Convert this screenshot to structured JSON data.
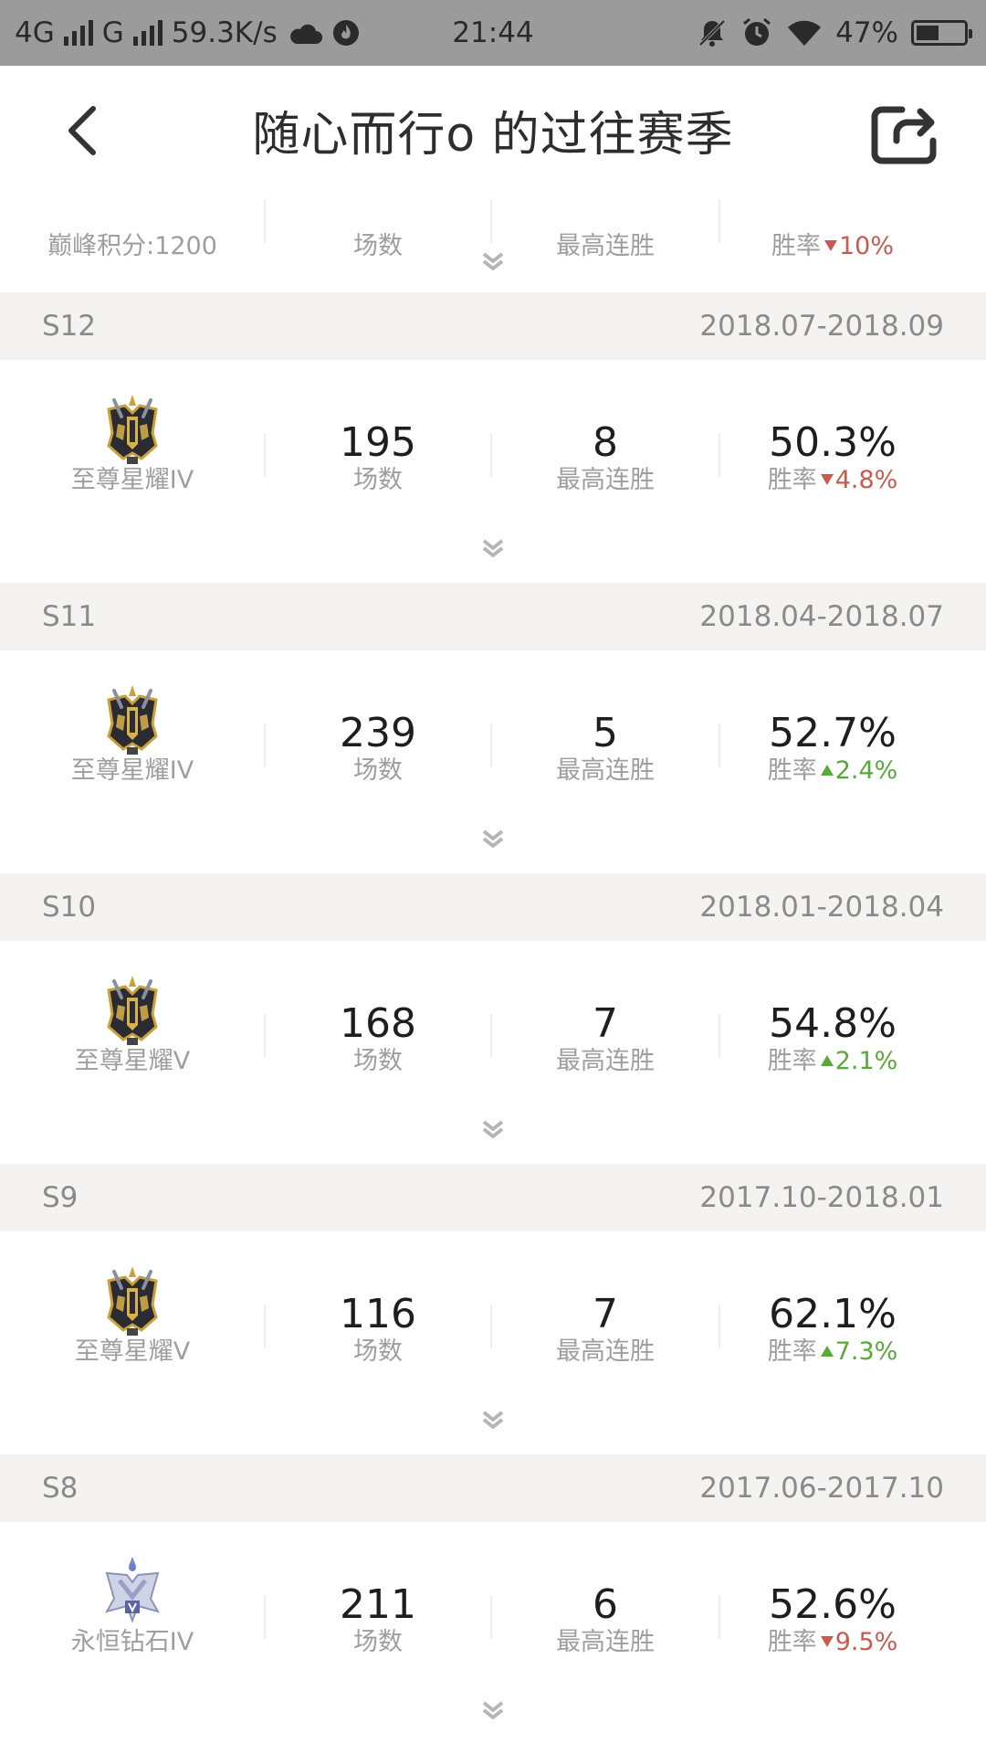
{
  "status_bar": {
    "network_1": "4G",
    "network_2": "G",
    "speed": "59.3K/s",
    "time": "21:44",
    "battery_text": "47%",
    "battery_level": 0.47
  },
  "nav": {
    "title": "随心而行o 的过往赛季"
  },
  "partial_row": {
    "rank_name": "巅峰积分:1200",
    "games_label": "场数",
    "streak_label": "最高连胜",
    "rate_label": "胜率",
    "rate_delta": "10%",
    "rate_delta_dir": "down"
  },
  "seasons": [
    {
      "name": "S12",
      "dates": "2018.07-2018.09",
      "rank_name": "至尊星耀IV",
      "rank_icon": "starry-emblem-icon",
      "games": "195",
      "games_label": "场数",
      "streak": "8",
      "streak_label": "最高连胜",
      "rate": "50.3%",
      "rate_label": "胜率",
      "rate_delta": "4.8%",
      "rate_delta_dir": "down"
    },
    {
      "name": "S11",
      "dates": "2018.04-2018.07",
      "rank_name": "至尊星耀IV",
      "rank_icon": "starry-emblem-icon",
      "games": "239",
      "games_label": "场数",
      "streak": "5",
      "streak_label": "最高连胜",
      "rate": "52.7%",
      "rate_label": "胜率",
      "rate_delta": "2.4%",
      "rate_delta_dir": "up"
    },
    {
      "name": "S10",
      "dates": "2018.01-2018.04",
      "rank_name": "至尊星耀Ⅴ",
      "rank_icon": "starry-emblem-icon",
      "games": "168",
      "games_label": "场数",
      "streak": "7",
      "streak_label": "最高连胜",
      "rate": "54.8%",
      "rate_label": "胜率",
      "rate_delta": "2.1%",
      "rate_delta_dir": "up"
    },
    {
      "name": "S9",
      "dates": "2017.10-2018.01",
      "rank_name": "至尊星耀Ⅴ",
      "rank_icon": "starry-emblem-icon",
      "games": "116",
      "games_label": "场数",
      "streak": "7",
      "streak_label": "最高连胜",
      "rate": "62.1%",
      "rate_label": "胜率",
      "rate_delta": "7.3%",
      "rate_delta_dir": "up"
    },
    {
      "name": "S8",
      "dates": "2017.06-2017.10",
      "rank_name": "永恒钻石IV",
      "rank_icon": "diamond-emblem-icon",
      "games": "211",
      "games_label": "场数",
      "streak": "6",
      "streak_label": "最高连胜",
      "rate": "52.6%",
      "rate_label": "胜率",
      "rate_delta": "9.5%",
      "rate_delta_dir": "down"
    }
  ],
  "colors": {
    "delta_up": "#5aa83a",
    "delta_down": "#c95a4f",
    "header_bg": "#f4f3f1",
    "status_bar_bg": "#9b9b9b"
  }
}
